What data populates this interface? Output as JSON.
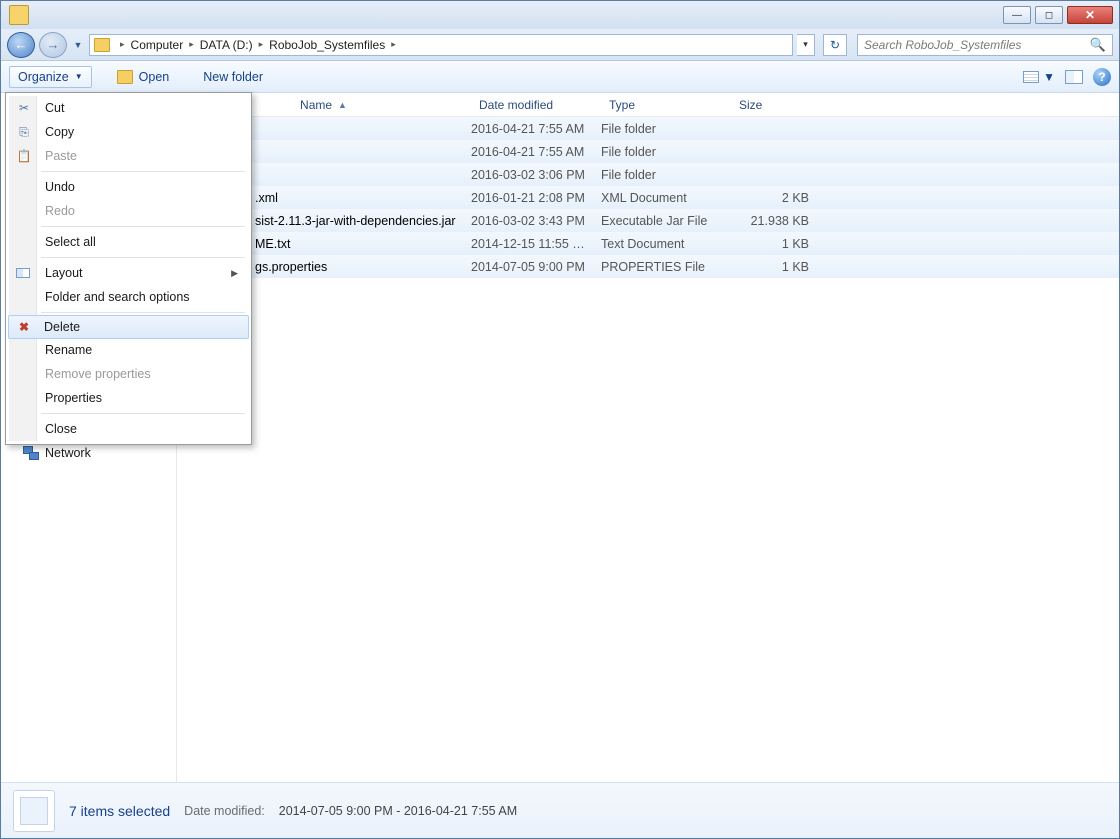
{
  "titlebar": {
    "minimize_glyph": "—",
    "maximize_glyph": "◻",
    "close_glyph": "✕"
  },
  "nav": {
    "back_glyph": "←",
    "forward_glyph": "→",
    "history_drop_glyph": "▼",
    "refresh_glyph": "↻",
    "addr_drop_glyph": "▾"
  },
  "breadcrumbs": {
    "root_glyph": "▸",
    "seg0": "Computer",
    "seg1": "DATA (D:)",
    "seg2": "RoboJob_Systemfiles",
    "chev": "▸"
  },
  "search": {
    "placeholder": "Search RoboJob_Systemfiles",
    "mag_glyph": "🔍"
  },
  "cmdbar": {
    "organize": "Organize",
    "organize_drop": "▼",
    "open": "Open",
    "newfolder": "New folder",
    "view_drop": "▼",
    "help_glyph": "?"
  },
  "columns": {
    "name": "Name",
    "name_sort_glyph": "▲",
    "date": "Date modified",
    "type": "Type",
    "size": "Size"
  },
  "rows": [
    {
      "name": "",
      "date": "2016-04-21 7:55 AM",
      "type": "File folder",
      "size": ""
    },
    {
      "name": "",
      "date": "2016-04-21 7:55 AM",
      "type": "File folder",
      "size": ""
    },
    {
      "name": "",
      "date": "2016-03-02 3:06 PM",
      "type": "File folder",
      "size": ""
    },
    {
      "name": ".xml",
      "date": "2016-01-21 2:08 PM",
      "type": "XML Document",
      "size": "2 KB"
    },
    {
      "name": "sist-2.11.3-jar-with-dependencies.jar",
      "date": "2016-03-02 3:43 PM",
      "type": "Executable Jar File",
      "size": "21.938 KB"
    },
    {
      "name": "ME.txt",
      "date": "2014-12-15 11:55 …",
      "type": "Text Document",
      "size": "1 KB"
    },
    {
      "name": "gs.properties",
      "date": "2014-07-05 9:00 PM",
      "type": "PROPERTIES File",
      "size": "1 KB"
    }
  ],
  "ctx": {
    "cut": "Cut",
    "copy": "Copy",
    "paste": "Paste",
    "undo": "Undo",
    "redo": "Redo",
    "selectall": "Select all",
    "layout": "Layout",
    "layout_arrow": "▶",
    "folderopts": "Folder and search options",
    "delete": "Delete",
    "rename": "Rename",
    "removeprops": "Remove properties",
    "properties": "Properties",
    "close": "Close",
    "cut_glyph": "✂",
    "copy_glyph": "⎘",
    "paste_glyph": "📋",
    "delete_glyph": "✖"
  },
  "navpane": {
    "network": "Network"
  },
  "details": {
    "summary": "7 items selected",
    "date_label": "Date modified:",
    "date_value": "2014-07-05 9:00 PM - 2016-04-21 7:55 AM"
  }
}
